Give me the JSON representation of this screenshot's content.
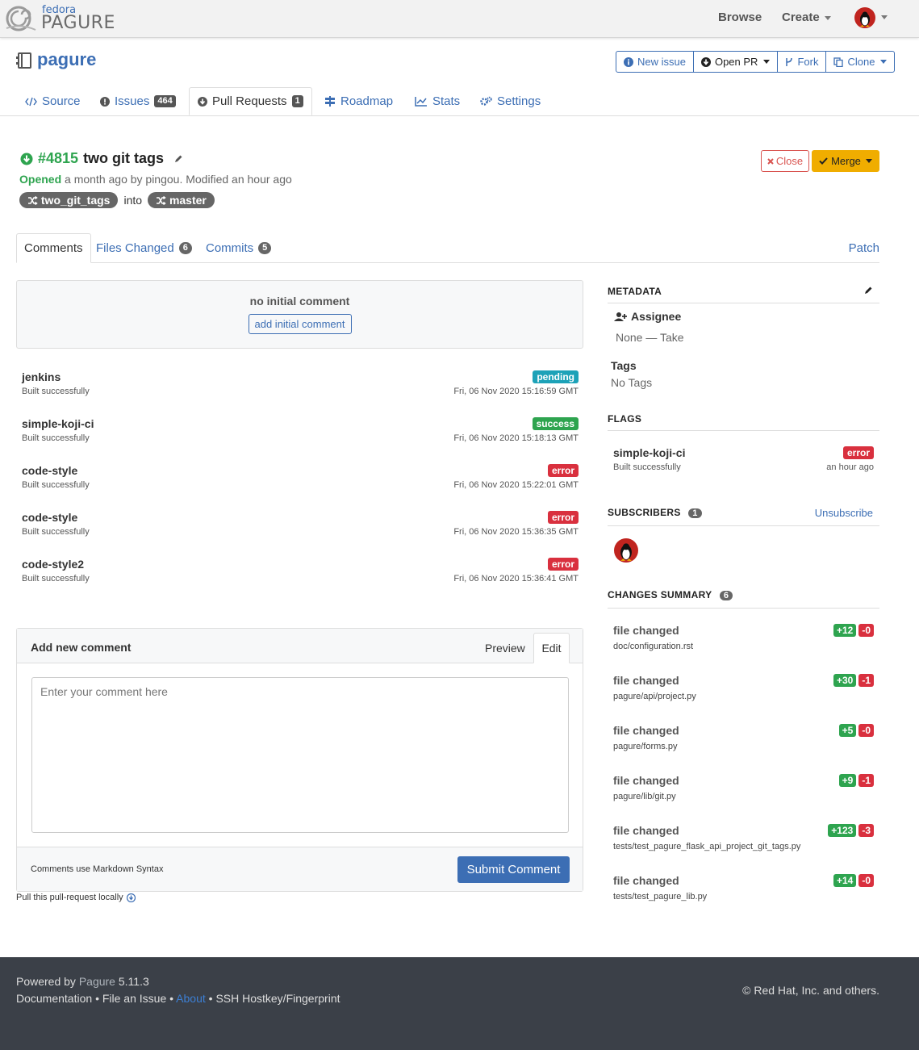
{
  "navbar": {
    "logo_top": "fedora",
    "logo_main": "PAGURE",
    "browse": "Browse",
    "create": "Create"
  },
  "project": {
    "name": "pagure",
    "actions": {
      "new_issue": "New issue",
      "open_pr": "Open PR",
      "fork": "Fork",
      "clone": "Clone"
    }
  },
  "tabs": [
    {
      "label": "Source"
    },
    {
      "label": "Issues",
      "count": "464"
    },
    {
      "label": "Pull Requests",
      "count": "1"
    },
    {
      "label": "Roadmap"
    },
    {
      "label": "Stats"
    },
    {
      "label": "Settings"
    }
  ],
  "pr": {
    "number": "#4815",
    "title": "two git tags",
    "opened_label": "Opened",
    "opened_rest": "a month ago by pingou. Modified an hour ago",
    "from_branch": "two_git_tags",
    "into": "into",
    "to_branch": "master",
    "close_label": "Close",
    "merge_label": "Merge"
  },
  "subtabs": {
    "comments": "Comments",
    "files_changed": "Files Changed",
    "files_changed_count": "6",
    "commits": "Commits",
    "commits_count": "5",
    "patch": "Patch"
  },
  "initial_comment": {
    "text": "no initial comment",
    "button": "add initial comment"
  },
  "flags": [
    {
      "name": "jenkins",
      "desc": "Built successfully",
      "status": "pending",
      "date": "Fri, 06 Nov 2020 15:16:59 GMT"
    },
    {
      "name": "simple-koji-ci",
      "desc": "Built successfully",
      "status": "success",
      "date": "Fri, 06 Nov 2020 15:18:13 GMT"
    },
    {
      "name": "code-style",
      "desc": "Built successfully",
      "status": "error",
      "date": "Fri, 06 Nov 2020 15:22:01 GMT"
    },
    {
      "name": "code-style",
      "desc": "Built successfully",
      "status": "error",
      "date": "Fri, 06 Nov 2020 15:36:35 GMT"
    },
    {
      "name": "code-style2",
      "desc": "Built successfully",
      "status": "error",
      "date": "Fri, 06 Nov 2020 15:36:41 GMT"
    }
  ],
  "comment_form": {
    "title": "Add new comment",
    "preview": "Preview",
    "edit": "Edit",
    "placeholder": "Enter your comment here",
    "markdown_note": "Comments use Markdown Syntax",
    "submit": "Submit Comment",
    "pull_locally": "Pull this pull-request locally"
  },
  "sidebar": {
    "metadata_h": "METADATA",
    "assignee_h": "Assignee",
    "assignee_v": "None — Take",
    "tags_h": "Tags",
    "tags_v": "No Tags",
    "flags_h": "FLAGS",
    "flag": {
      "name": "simple-koji-ci",
      "desc": "Built successfully",
      "status": "error",
      "when": "an hour ago"
    },
    "subscribers_h": "SUBSCRIBERS",
    "subscribers_count": "1",
    "unsubscribe": "Unsubscribe",
    "changes_h": "CHANGES SUMMARY",
    "changes_count": "6",
    "files": [
      {
        "word": "file",
        "action": "changed",
        "path": "doc/configuration.rst",
        "add": "+12",
        "del": "-0"
      },
      {
        "word": "file",
        "action": "changed",
        "path": "pagure/api/project.py",
        "add": "+30",
        "del": "-1"
      },
      {
        "word": "file",
        "action": "changed",
        "path": "pagure/forms.py",
        "add": "+5",
        "del": "-0"
      },
      {
        "word": "file",
        "action": "changed",
        "path": "pagure/lib/git.py",
        "add": "+9",
        "del": "-1"
      },
      {
        "word": "file",
        "action": "changed",
        "path": "tests/test_pagure_flask_api_project_git_tags.py",
        "add": "+123",
        "del": "-3"
      },
      {
        "word": "file",
        "action": "changed",
        "path": "tests/test_pagure_lib.py",
        "add": "+14",
        "del": "-0"
      }
    ]
  },
  "footer": {
    "powered_by": "Powered by",
    "pagure_link": "Pagure",
    "version": "5.11.3",
    "documentation": "Documentation",
    "sep": "•",
    "file_issue": "File an Issue",
    "about": "About",
    "ssh": "SSH Hostkey/Fingerprint",
    "copyright": "© Red Hat, Inc. and others."
  },
  "colors": {
    "accent": "#3c6eb4",
    "success": "#2ea44f",
    "error": "#d9303e",
    "pending": "#1da2b8",
    "merge": "#f0ad00",
    "footer_bg": "#3b4048"
  },
  "icons": [
    "fedora-swirl-icon",
    "avatar-icon",
    "repo-icon",
    "info-icon",
    "pr-icon",
    "fork-icon",
    "clone-icon",
    "code-icon",
    "issue-icon",
    "roadmap-icon",
    "stats-icon",
    "settings-icon",
    "pr-open-icon",
    "pencil-icon",
    "shuffle-icon",
    "times-icon",
    "check-icon",
    "user-plus-icon",
    "download-circle-icon"
  ]
}
